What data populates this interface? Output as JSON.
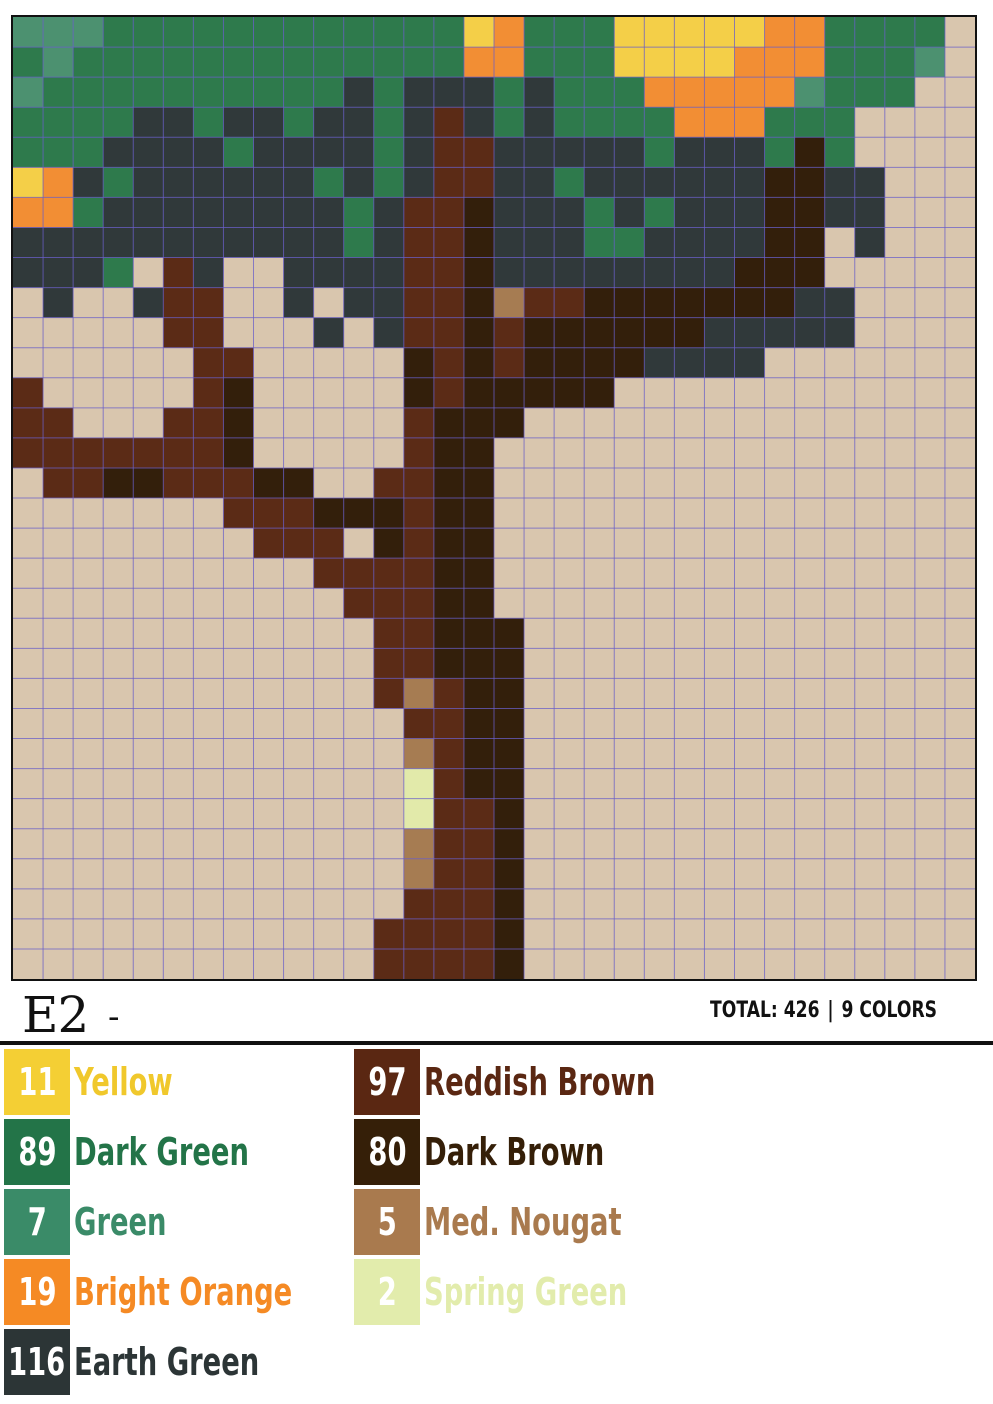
{
  "header": {
    "code": "E2",
    "dash": "-",
    "total_label": "TOTAL: 426",
    "colors_label": "9 COLORS",
    "separator": "|"
  },
  "mosaic": {
    "columns": 32,
    "rows": 32,
    "grid_line_color": "#6a5fc8",
    "palette": {
      "Y": "#f4cf48",
      "G": "#2e7a4c",
      "g": "#4c9170",
      "O": "#f28e34",
      "E": "#30393a",
      "R": "#5b2b16",
      "D": "#331f0b",
      "N": "#a67c52",
      "S": "#e2eaaa",
      "T": "#d9c6ae"
    },
    "rows_data": [
      "gggGGGGGGGGGGGGYOGGGYYYYYOOGGGGT",
      "GgGGGGGGGGGGGGGOOGGGYYYYOOOGGGgT",
      "gGGGGGGGGGGEGEEEGEGGGOOOOOgGGGTT",
      "GGGGEEGEEGEEGEREGEGGGGOOOGGGTTTT",
      "GGGEEEEGEEEEGERREEEEEGEEEGDGTTTT",
      "YOEGEEEEEEGEGERREEGEEEEEEDDEETTT",
      "OOGEEEEEEEEGERRDEEEGEGEEEDDEETTT",
      "EEEEEEEEEEEGERRDEEEGGEEEEDDTETTT",
      "EEEGTRETTEEEERRDEEEEEEEEDDDTTTTT",
      "TETTERRTTETEERRDNRRDDDDDDDEETTTT",
      "TTTTTRRTTTETERRDRDDDDDDEEEEETTTT",
      "TTTTTTRRTTTTTDRDRDDDDEEEETTTTTTT",
      "RTTTTTRDTTTTTDRDDDDDTTTTTTTTTTTT",
      "RRTTTRRDTTTTTRDDDTTTTTTTTTTTTTTT",
      "RRRRRRRDTTTTTRDDTTTTTTTTTTTTTTTT",
      "TRRDDRRRDDTTRRDDTTTTTTTTTTTTTTTT",
      "TTTTTTTRRRDDDRDDTTTTTTTTTTTTTTTT",
      "TTTTTTTTRRRTDRDDTTTTTTTTTTTTTTTT",
      "TTTTTTTTTTRRRRDDTTTTTTTTTTTTTTTT",
      "TTTTTTTTTTTRRRDDTTTTTTTTTTTTTTTT",
      "TTTTTTTTTTTTRRDDDTTTTTTTTTTTTTTT",
      "TTTTTTTTTTTTRRDDDTTTTTTTTTTTTTTT",
      "TTTTTTTTTTTTRNRDDTTTTTTTTTTTTTTT",
      "TTTTTTTTTTTTTRRDDTTTTTTTTTTTTTTT",
      "TTTTTTTTTTTTTNRDDTTTTTTTTTTTTTTT",
      "TTTTTTTTTTTTTSRDDTTTTTTTTTTTTTTT",
      "TTTTTTTTTTTTTSRRDTTTTTTTTTTTTTTT",
      "TTTTTTTTTTTTTNRRDTTTTTTTTTTTTTTT",
      "TTTTTTTTTTTTTNRRDTTTTTTTTTTTTTTT",
      "TTTTTTTTTTTTTRRRDTTTTTTTTTTTTTTT",
      "TTTTTTTTTTTTRRRRDTTTTTTTTTTTTTTT",
      "TTTTTTTTTTTTRRRRDTTTTTTTTTTTTTTT"
    ]
  },
  "legend": [
    {
      "count": "11",
      "name": "Yellow",
      "color": "#f4cf34",
      "text_color": "#f0c82c",
      "count_color": "#ffffff"
    },
    {
      "count": "89",
      "name": "Dark Green",
      "color": "#237448",
      "text_color": "#237448",
      "count_color": "#ffffff"
    },
    {
      "count": "7",
      "name": "Green",
      "color": "#3a8b68",
      "text_color": "#3a8b68",
      "count_color": "#ffffff"
    },
    {
      "count": "19",
      "name": "Bright Orange",
      "color": "#f58a24",
      "text_color": "#f58a24",
      "count_color": "#ffffff"
    },
    {
      "count": "116",
      "name": "Earth Green",
      "color": "#2c3536",
      "text_color": "#2c3536",
      "count_color": "#ffffff"
    },
    {
      "count": "97",
      "name": "Reddish Brown",
      "color": "#5a2712",
      "text_color": "#5a2712",
      "count_color": "#ffffff"
    },
    {
      "count": "80",
      "name": "Dark Brown",
      "color": "#351f08",
      "text_color": "#351f08",
      "count_color": "#ffffff"
    },
    {
      "count": "5",
      "name": "Med. Nougat",
      "color": "#a97a4e",
      "text_color": "#a97a4e",
      "count_color": "#ffffff"
    },
    {
      "count": "2",
      "name": "Spring Green",
      "color": "#e2ecac",
      "text_color": "#e2ecac",
      "count_color": "#ffffff"
    }
  ]
}
